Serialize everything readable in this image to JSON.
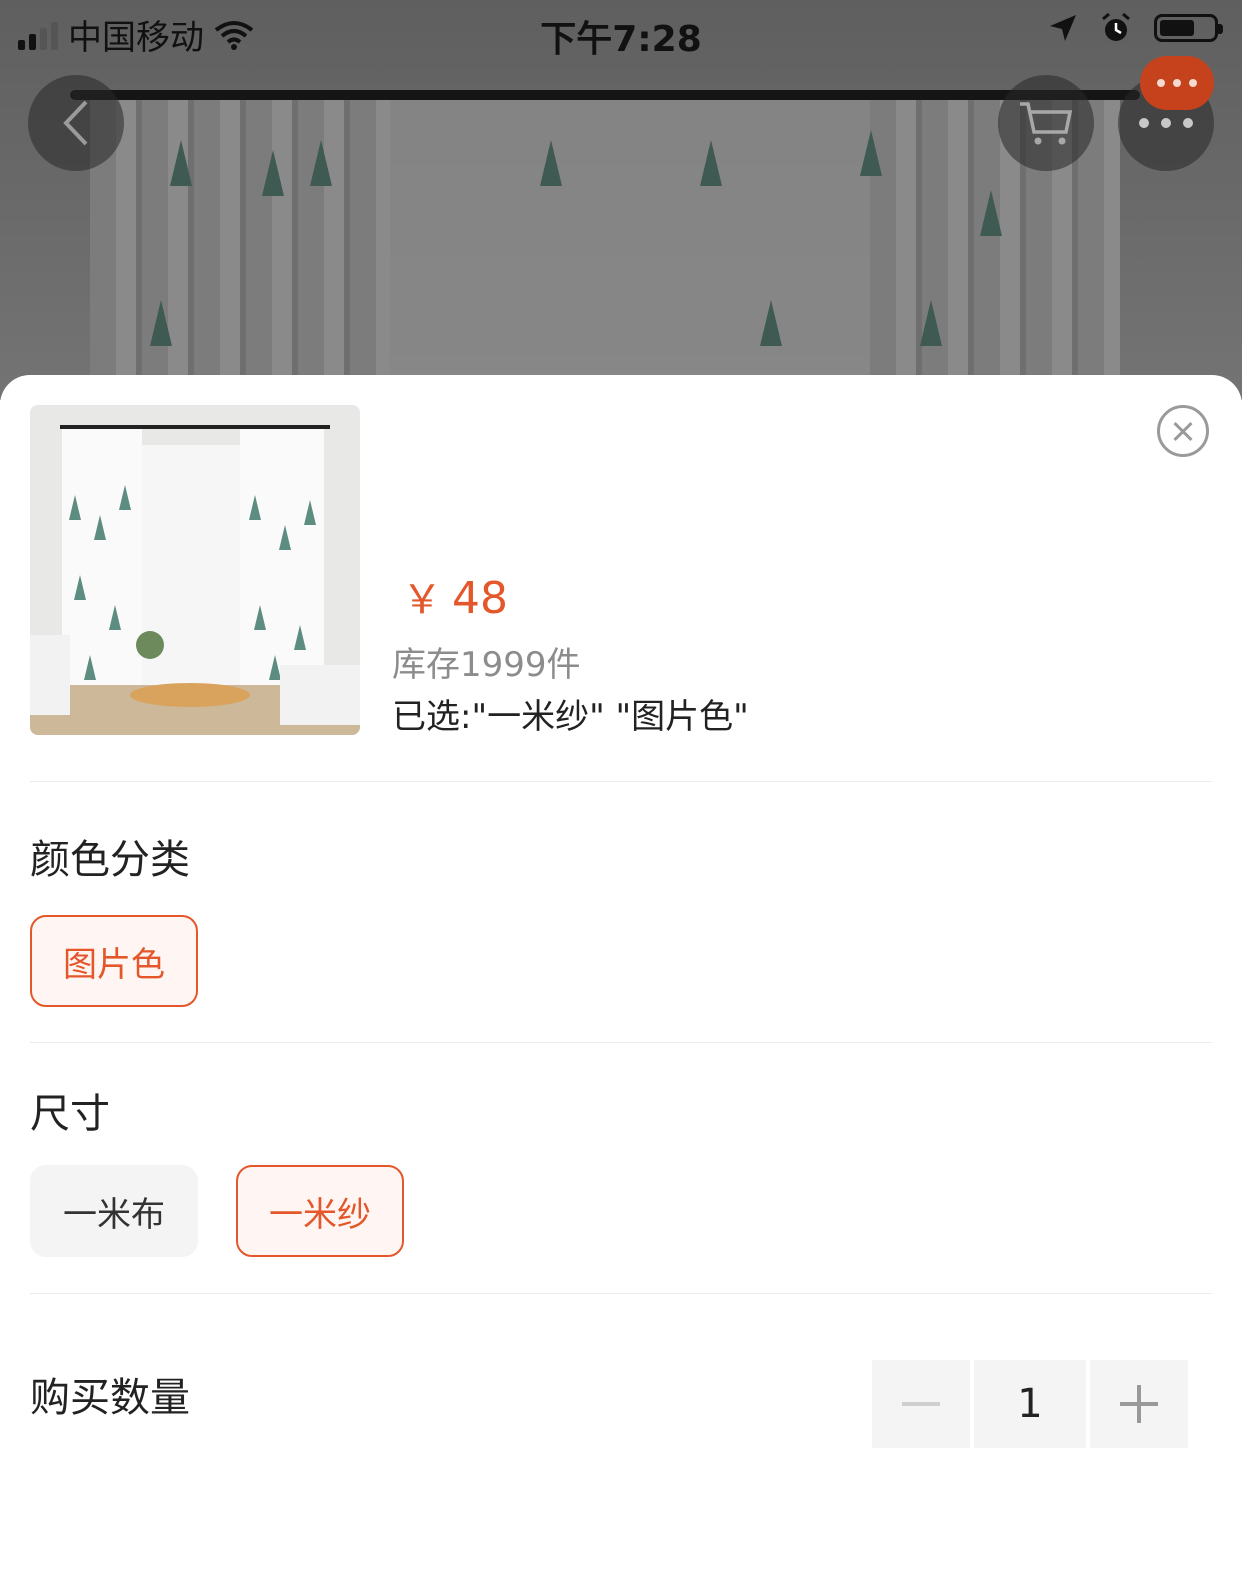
{
  "status_bar": {
    "carrier": "中国移动",
    "time": "下午7:28",
    "battery_level": 0.65
  },
  "nav": {
    "back_icon": "chevron-left-icon",
    "cart_icon": "cart-icon",
    "more_icon": "more-dots-icon",
    "badge_icon": "more-dots-icon"
  },
  "product": {
    "price_symbol": "￥",
    "price": "48",
    "stock": "库存1999件",
    "selected": "已选:\"一米纱\" \"图片色\""
  },
  "color_section": {
    "title": "颜色分类",
    "options": [
      {
        "label": "图片色",
        "selected": true
      }
    ]
  },
  "size_section": {
    "title": "尺寸",
    "options": [
      {
        "label": "一米布",
        "selected": false
      },
      {
        "label": "一米纱",
        "selected": true
      }
    ]
  },
  "quantity_section": {
    "title": "购买数量",
    "value": "1"
  },
  "colors": {
    "accent": "#e4572a",
    "badge": "#c5421d"
  }
}
